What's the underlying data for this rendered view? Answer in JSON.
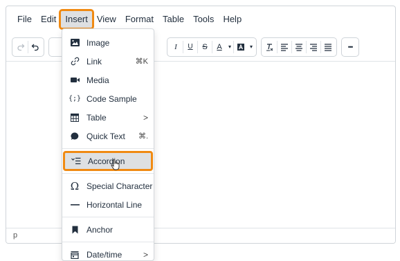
{
  "menubar": {
    "items": [
      "File",
      "Edit",
      "Insert",
      "View",
      "Format",
      "Table",
      "Tools",
      "Help"
    ],
    "active": "Insert"
  },
  "toolbar": {
    "undo_icon": "undo-icon",
    "redo_icon": "redo-icon",
    "italic_label": "I",
    "underline_label": "U",
    "strikethrough_label": "S",
    "text_color_label": "A",
    "more_label": "•••"
  },
  "statusbar": {
    "path": "p"
  },
  "insert_menu": {
    "items": [
      {
        "label": "Image",
        "icon": "image-icon",
        "shortcut": "",
        "submenu": false
      },
      {
        "label": "Link",
        "icon": "link-icon",
        "shortcut": "⌘K",
        "submenu": false
      },
      {
        "label": "Media",
        "icon": "media-icon",
        "shortcut": "",
        "submenu": false
      },
      {
        "label": "Code Sample",
        "icon": "code-sample-icon",
        "shortcut": "",
        "submenu": false
      },
      {
        "label": "Table",
        "icon": "table-icon",
        "shortcut": "",
        "submenu": true
      },
      {
        "label": "Quick Text",
        "icon": "quick-text-icon",
        "shortcut": "⌘.",
        "submenu": false
      },
      {
        "label": "Accordion",
        "icon": "accordion-icon",
        "shortcut": "",
        "submenu": false,
        "highlighted": true
      },
      {
        "label": "Special Character",
        "icon": "special-character-icon",
        "shortcut": "",
        "submenu": false
      },
      {
        "label": "Horizontal Line",
        "icon": "horizontal-line-icon",
        "shortcut": "",
        "submenu": false
      },
      {
        "label": "Anchor",
        "icon": "anchor-icon",
        "shortcut": "",
        "submenu": false
      },
      {
        "label": "Date/time",
        "icon": "date-time-icon",
        "shortcut": "",
        "submenu": true
      }
    ],
    "chevron": ">",
    "glyphs": {
      "code_sample": "{;}",
      "special_character": "Ω"
    }
  },
  "colors": {
    "highlight_outline": "#f08a12",
    "highlight_bg": "#dee0e2",
    "text": "#222f3e"
  }
}
